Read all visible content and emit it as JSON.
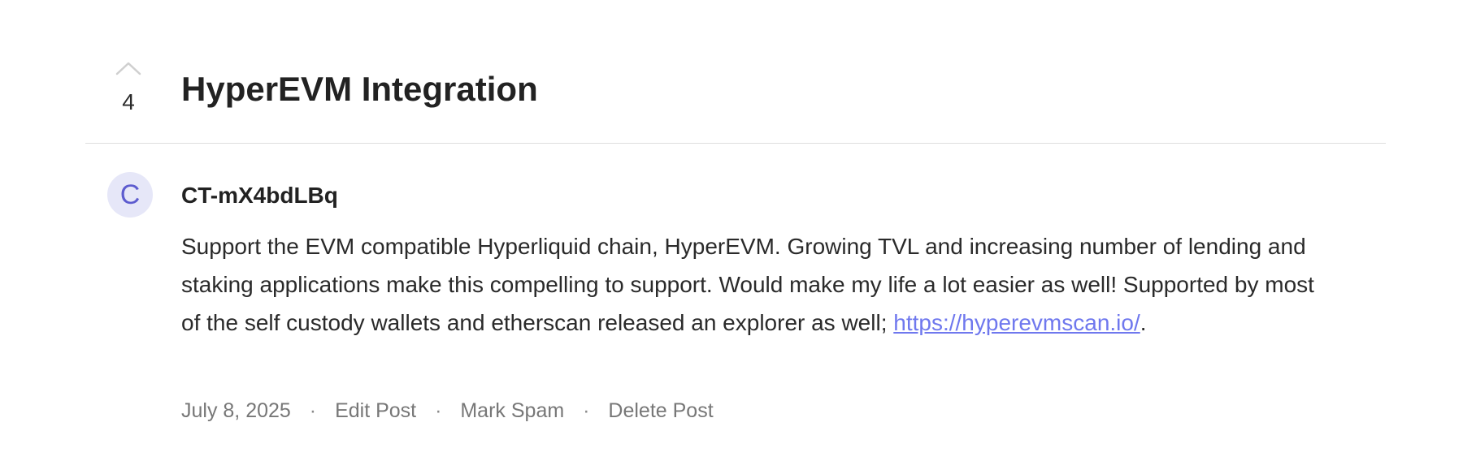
{
  "post": {
    "votes": "4",
    "title": "HyperEVM Integration",
    "author": {
      "initial": "C",
      "name": "CT-mX4bdLBq"
    },
    "body": {
      "text": "Support the EVM compatible Hyperliquid chain, HyperEVM. Growing TVL and increasing number of lending and staking applications make this compelling to support. Would make my life a lot easier as well! Supported by most of the self custody wallets and etherscan released an explorer as well; ",
      "link_text": "https://hyperevmscan.io/",
      "suffix": "."
    },
    "meta": {
      "date": "July 8, 2025",
      "separator": "·",
      "edit_label": "Edit Post",
      "spam_label": "Mark Spam",
      "delete_label": "Delete Post"
    }
  },
  "colors": {
    "avatar_bg": "#e6e7f8",
    "avatar_text": "#5d5ccf",
    "link": "#6f78ee",
    "meta_text": "#777777",
    "divider": "#dedede"
  },
  "icons": {
    "upvote": "chevron-up-icon"
  }
}
